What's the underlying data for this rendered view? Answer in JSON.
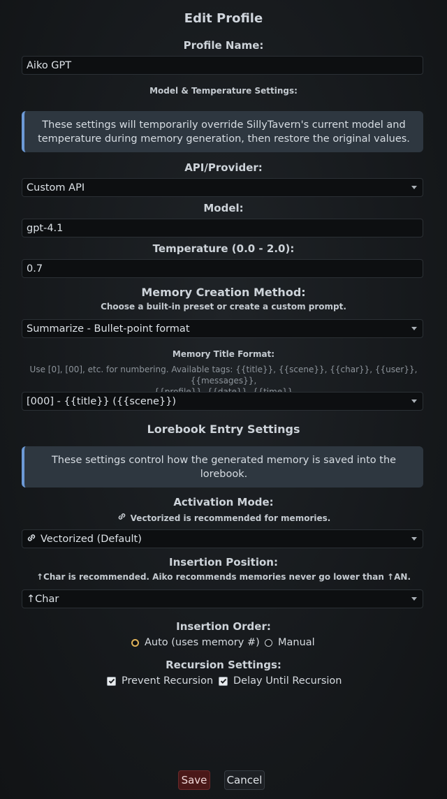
{
  "dialog": {
    "title": "Edit Profile"
  },
  "profile": {
    "label": "Profile Name:",
    "value": "Aiko GPT"
  },
  "model_section": {
    "heading": "Model & Temperature Settings:",
    "info": "These settings will temporarily override SillyTavern's current model and temperature during memory generation, then restore the original values."
  },
  "api": {
    "label": "API/Provider:",
    "value": "Custom API"
  },
  "model": {
    "label": "Model:",
    "value": "gpt-4.1"
  },
  "temperature": {
    "label": "Temperature (0.0 - 2.0):",
    "value": "0.7"
  },
  "memory_method": {
    "label": "Memory Creation Method:",
    "hint": "Choose a built-in preset or create a custom prompt.",
    "value": "Summarize - Bullet-point format"
  },
  "title_format": {
    "label": "Memory Title Format:",
    "hint_line1": "Use [0], [00], etc. for numbering. Available tags: {{title}}, {{scene}}, {{char}}, {{user}}, {{messages}},",
    "hint_line2": "{{profile}}, {{date}}, {{time}}",
    "value": "[000] - {{title}} ({{scene}})"
  },
  "lorebook": {
    "heading": "Lorebook Entry Settings",
    "info": "These settings control how the generated memory is saved into the lorebook."
  },
  "activation": {
    "label": "Activation Mode:",
    "hint": "Vectorized is recommended for memories.",
    "value": "Vectorized (Default)"
  },
  "insertion_position": {
    "label": "Insertion Position:",
    "hint": "↑Char is recommended. Aiko recommends memories never go lower than ↑AN.",
    "value": "↑Char"
  },
  "insertion_order": {
    "label": "Insertion Order:",
    "auto_label": "Auto (uses memory #)",
    "manual_label": "Manual",
    "selected": "auto"
  },
  "recursion": {
    "label": "Recursion Settings:",
    "prevent_label": "Prevent Recursion",
    "prevent_checked": true,
    "delay_label": "Delay Until Recursion",
    "delay_checked": true
  },
  "buttons": {
    "save": "Save",
    "cancel": "Cancel"
  },
  "colors": {
    "accent_border": "#6d9ad6",
    "save_bg": "#4a1818",
    "radio_selected": "#e0b35a"
  }
}
